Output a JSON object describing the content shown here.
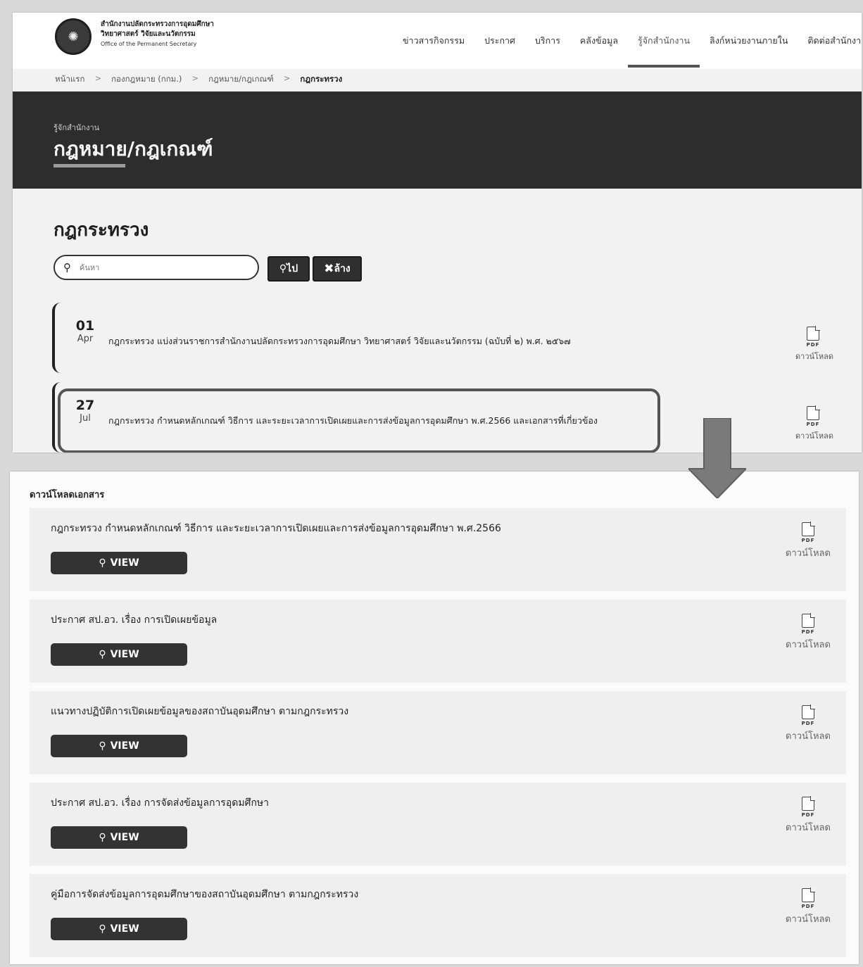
{
  "header": {
    "logo_line1": "สำนักงานปลัดกระทรวงการอุดมศึกษา",
    "logo_line2": "วิทยาศาสตร์ วิจัยและนวัตกรรม",
    "logo_line3": "Office of the Permanent Secretary",
    "nav": [
      {
        "label": "ข่าวสารกิจกรรม"
      },
      {
        "label": "ประกาศ"
      },
      {
        "label": "บริการ"
      },
      {
        "label": "คลังข้อมูล"
      },
      {
        "label": "รู้จักสำนักงาน"
      },
      {
        "label": "ลิงก์หน่วยงานภายใน"
      },
      {
        "label": "ติดต่อสำนักงาน"
      }
    ]
  },
  "breadcrumb": {
    "home": "หน้าแรก",
    "sep": ">",
    "item1": "กองกฎหมาย (กกม.)",
    "item2": "กฎหมาย/กฎเกณฑ์",
    "current": "กฎกระทรวง"
  },
  "hero": {
    "small": "รู้จักสำนักงาน",
    "title": "กฎหมาย/กฎเกณฑ์"
  },
  "section": {
    "title": "กฎกระทรวง",
    "search_placeholder": "ค้นหา",
    "go_label": "ไป",
    "clear_label": "ล้าง"
  },
  "laws": [
    {
      "day": "01",
      "month": "Apr",
      "title": "กฎกระทรวง แบ่งส่วนราชการสำนักงานปลัดกระทรวงการอุดมศึกษา วิทยาศาสตร์ วิจัยและนวัตกรรม (ฉบับที่ ๒) พ.ศ. ๒๕๖๗",
      "pdf": "PDF",
      "download": "ดาวน์โหลด"
    },
    {
      "day": "27",
      "month": "Jul",
      "title": "กฎกระทรวง กำหนดหลักเกณฑ์ วิธีการ และระยะเวลาการเปิดเผยและการส่งข้อมูลการอุดมศึกษา พ.ศ.2566 และเอกสารที่เกี่ยวข้อง",
      "pdf": "PDF",
      "download": "ดาวน์โหลด"
    }
  ],
  "downloads": {
    "title": "ดาวน์โหลดเอกสาร",
    "items": [
      {
        "title": "กฎกระทรวง กำหนดหลักเกณฑ์ วิธีการ และระยะเวลาการเปิดเผยและการส่งข้อมูลการอุดมศึกษา พ.ศ.2566",
        "view": "VIEW",
        "pdf": "PDF",
        "download": "ดาวน์โหลด"
      },
      {
        "title": "ประกาศ สป.อว. เรื่อง การเปิดเผยข้อมูล",
        "view": "VIEW",
        "pdf": "PDF",
        "download": "ดาวน์โหลด"
      },
      {
        "title": "แนวทางปฏิบัติการเปิดเผยข้อมูลของสถาบันอุดมศึกษา ตามกฎกระทรวง",
        "view": "VIEW",
        "pdf": "PDF",
        "download": "ดาวน์โหลด"
      },
      {
        "title": "ประกาศ สป.อว. เรื่อง การจัดส่งข้อมูลการอุดมศึกษา",
        "view": "VIEW",
        "pdf": "PDF",
        "download": "ดาวน์โหลด"
      },
      {
        "title": "คู่มือการจัดส่งข้อมูลการอุดมศึกษาของสถาบันอุดมศึกษา ตามกฎกระทรวง",
        "view": "VIEW",
        "pdf": "PDF",
        "download": "ดาวน์โหลด"
      }
    ]
  },
  "colors": {
    "hero_bg": "#2d2d2d",
    "button_bg": "#2f2f2f",
    "arrow": "#7a7a7a"
  }
}
